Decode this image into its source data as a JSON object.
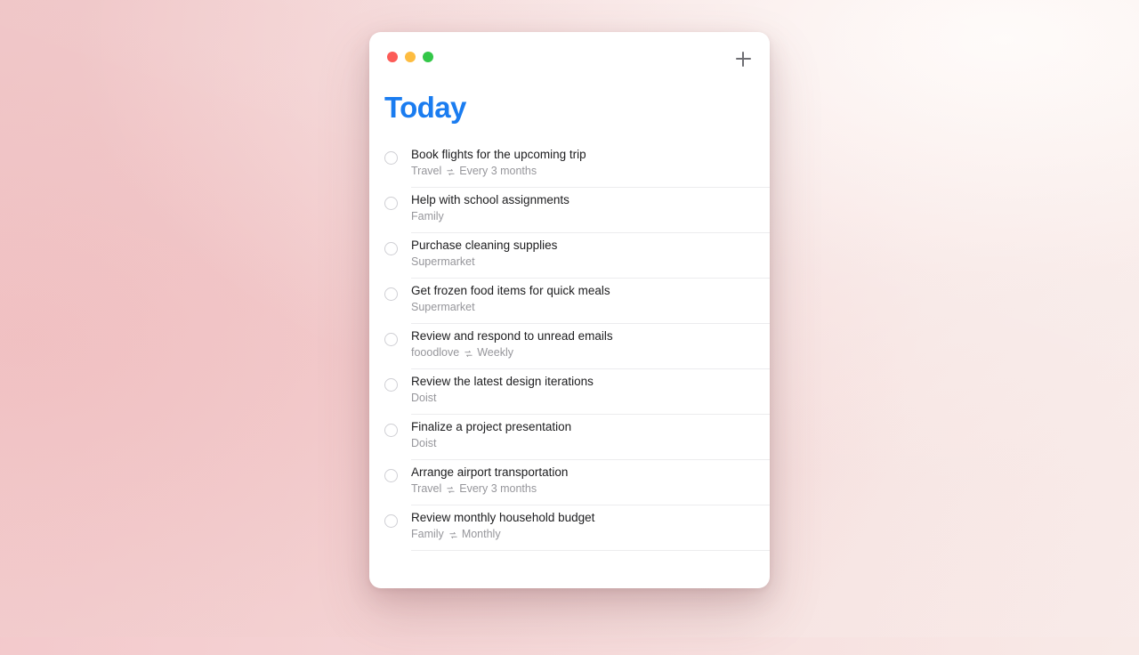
{
  "window": {
    "traffic_lights": [
      {
        "name": "close",
        "color": "#fc5b57"
      },
      {
        "name": "minimize",
        "color": "#fdbc40"
      },
      {
        "name": "maximize",
        "color": "#33c748"
      }
    ],
    "add_button_icon": "plus-icon",
    "add_button_label": "+"
  },
  "header": {
    "title": "Today",
    "title_color": "#1a7cf0"
  },
  "icons": {
    "recurring": "recurring-icon",
    "checkbox": "task-checkbox"
  },
  "tasks": [
    {
      "title": "Book flights for the upcoming trip",
      "project": "Travel",
      "recurrence": "Every 3 months"
    },
    {
      "title": "Help with school assignments",
      "project": "Family",
      "recurrence": ""
    },
    {
      "title": "Purchase cleaning supplies",
      "project": "Supermarket",
      "recurrence": ""
    },
    {
      "title": "Get frozen food items for quick meals",
      "project": "Supermarket",
      "recurrence": ""
    },
    {
      "title": "Review and respond to unread emails",
      "project": "fooodlove",
      "recurrence": "Weekly"
    },
    {
      "title": "Review the latest design iterations",
      "project": "Doist",
      "recurrence": ""
    },
    {
      "title": "Finalize a project presentation",
      "project": "Doist",
      "recurrence": ""
    },
    {
      "title": "Arrange airport transportation",
      "project": "Travel",
      "recurrence": "Every 3 months"
    },
    {
      "title": "Review monthly household budget",
      "project": "Family",
      "recurrence": "Monthly"
    }
  ]
}
